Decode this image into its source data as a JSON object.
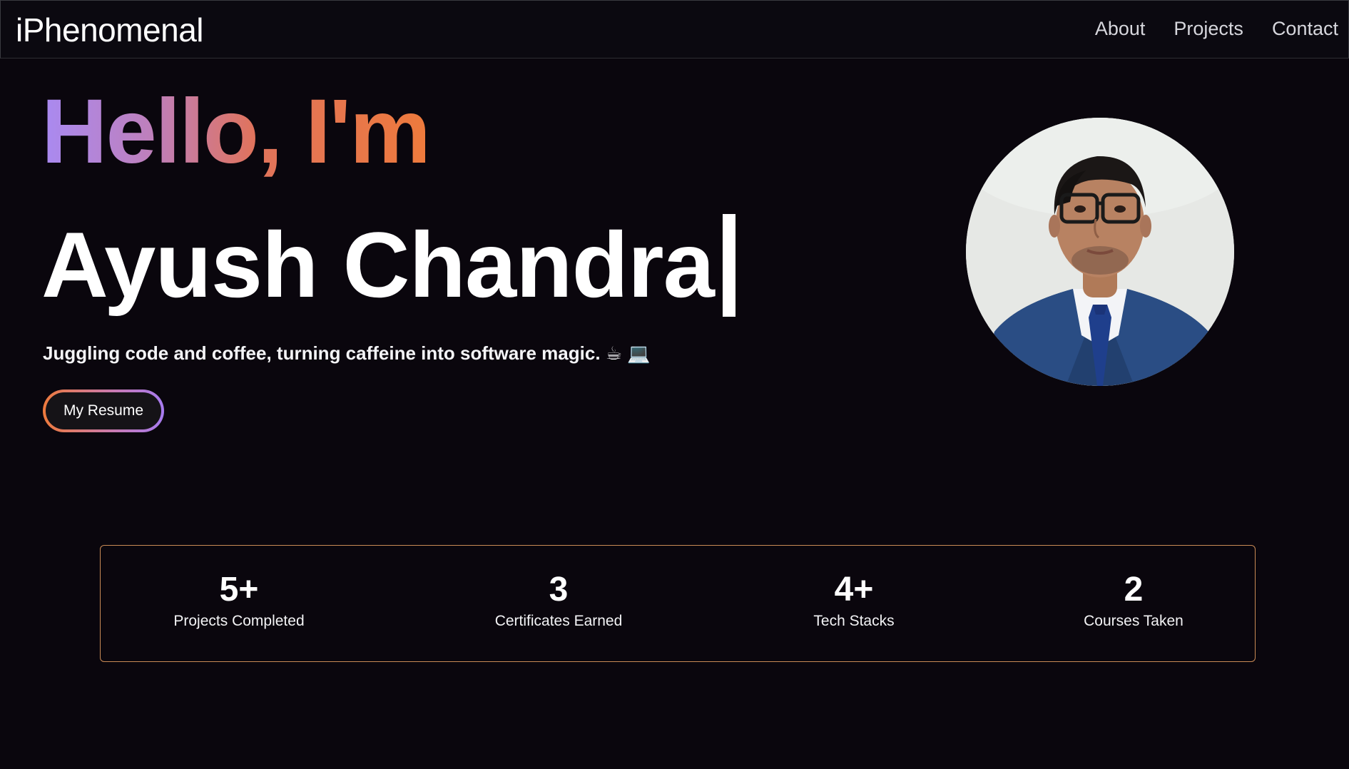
{
  "nav": {
    "brand": "iPhenomenal",
    "links": [
      "About",
      "Projects",
      "Contact"
    ]
  },
  "hero": {
    "greeting": "Hello, I'm",
    "name": "Ayush Chandra",
    "tagline": "Juggling code and coffee, turning caffeine into software magic. ☕ 💻",
    "resume_button": "My Resume"
  },
  "stats": [
    {
      "value": "5+",
      "label": "Projects Completed"
    },
    {
      "value": "3",
      "label": "Certificates Earned"
    },
    {
      "value": "4+",
      "label": "Tech Stacks"
    },
    {
      "value": "2",
      "label": "Courses Taken"
    }
  ],
  "colors": {
    "background": "#0a060d",
    "gradient_start": "#a98af2",
    "gradient_end": "#ee7a3c",
    "stats_border": "#c98a55"
  }
}
